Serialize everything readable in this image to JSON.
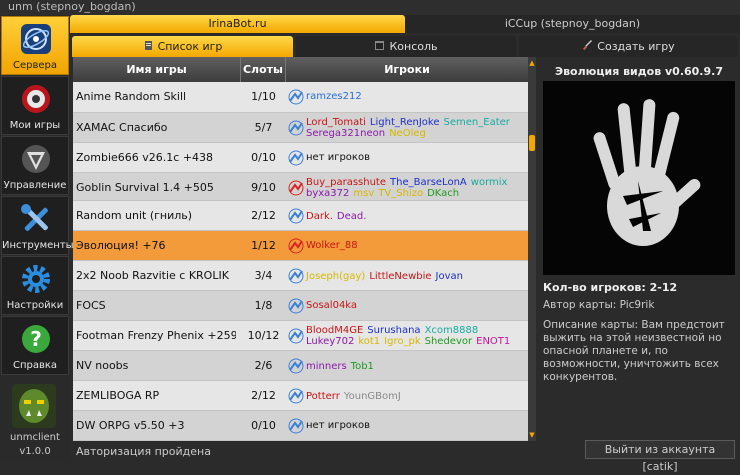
{
  "window": {
    "title": "unm (stepnoy_bogdan)"
  },
  "sidebar": {
    "items": [
      {
        "label": "Сервера",
        "icon": "globe-icon"
      },
      {
        "label": "Мои игры",
        "icon": "joystick-icon"
      },
      {
        "label": "Управление",
        "icon": "dota-logo-icon"
      },
      {
        "label": "Инструменты",
        "icon": "tools-icon"
      },
      {
        "label": "Настройки",
        "icon": "gear-icon"
      },
      {
        "label": "Справка",
        "icon": "help-icon"
      }
    ],
    "client": {
      "name": "unmclient",
      "version": "v1.0.0"
    }
  },
  "tabs": {
    "server1": "IrinaBot.ru",
    "server2": "iCCup (stepnoy_bogdan)"
  },
  "subtabs": {
    "games": "Список игр",
    "console": "Консоль",
    "create": "Создать игру"
  },
  "table": {
    "headers": {
      "name": "Имя игры",
      "slots": "Слоты",
      "players": "Игроки"
    },
    "rows": [
      {
        "name": "Anime Random Skill",
        "slots": "1/10",
        "players": [
          {
            "n": "ramzes212",
            "c": "#2a6fd6"
          }
        ]
      },
      {
        "name": "XAMAC Спасибо",
        "slots": "5/7",
        "players": [
          {
            "n": "Lord_Tomati",
            "c": "#c71515"
          },
          {
            "n": "Light_RenJoke",
            "c": "#1c2fc9"
          },
          {
            "n": "Semen_Eater",
            "c": "#18aaa0"
          },
          {
            "n": "Serega321neon",
            "c": "#8a1aa8"
          },
          {
            "n": "NeOleg",
            "c": "#d6b800"
          }
        ]
      },
      {
        "name": "Zombie666 v26.1c +438",
        "slots": "0/10",
        "players": [
          {
            "n": "нет игроков",
            "c": "#111111"
          }
        ]
      },
      {
        "name": "Goblin Survival 1.4 +505",
        "slots": "9/10",
        "players": [
          {
            "n": "Buy_parasshute",
            "c": "#c71515"
          },
          {
            "n": "The_BarseLonA",
            "c": "#1c2fc9"
          },
          {
            "n": "wormix",
            "c": "#18aaa0"
          },
          {
            "n": "byxa372",
            "c": "#8a1aa8"
          },
          {
            "n": "msv",
            "c": "#d6b800"
          },
          {
            "n": "TV_Shizo",
            "c": "#d6b800"
          },
          {
            "n": "DKach",
            "c": "#1f9a1f"
          }
        ]
      },
      {
        "name": "Random unit (гниль)",
        "slots": "2/12",
        "players": [
          {
            "n": "Dark.",
            "c": "#c71515"
          },
          {
            "n": "Dead.",
            "c": "#8a1aa8"
          }
        ]
      },
      {
        "name": "Эволюция!  +76",
        "slots": "1/12",
        "players": [
          {
            "n": "Wolker_88",
            "c": "#c71515"
          }
        ]
      },
      {
        "name": "2x2 Noob Razvitie c KROLIK",
        "slots": "3/4",
        "players": [
          {
            "n": "Joseph(gay)",
            "c": "#d6b800"
          },
          {
            "n": "LittleNewbie",
            "c": "#c71515"
          },
          {
            "n": "Jovan",
            "c": "#1c2fc9"
          }
        ]
      },
      {
        "name": "FOCS",
        "slots": "1/8",
        "players": [
          {
            "n": "Sosal04ka",
            "c": "#c71515"
          }
        ]
      },
      {
        "name": "Footman Frenzy Phenix +2592",
        "slots": "10/12",
        "players": [
          {
            "n": "BloodM4GE",
            "c": "#c71515"
          },
          {
            "n": "Surushana",
            "c": "#1c2fc9"
          },
          {
            "n": "Xcom8888",
            "c": "#18aaa0"
          },
          {
            "n": "Lukey702",
            "c": "#8a1aa8"
          },
          {
            "n": "kot1",
            "c": "#d6b800"
          },
          {
            "n": "Igro_pk",
            "c": "#d6b800"
          },
          {
            "n": "Shedevor",
            "c": "#1f9a1f"
          },
          {
            "n": "ENOT1",
            "c": "#c71599"
          }
        ]
      },
      {
        "name": "NV noobs",
        "slots": "2/6",
        "players": [
          {
            "n": "minners",
            "c": "#8a1aa8"
          },
          {
            "n": "Tob1",
            "c": "#1f9a1f"
          }
        ]
      },
      {
        "name": "ZEMLIBOGA RP",
        "slots": "2/12",
        "players": [
          {
            "n": "Potterr",
            "c": "#c71515"
          },
          {
            "n": "YounGBomJ",
            "c": "#8a8a8a"
          }
        ]
      },
      {
        "name": "DW ORPG v5.50 +3",
        "slots": "0/10",
        "players": [
          {
            "n": "нет игроков",
            "c": "#111111"
          }
        ]
      }
    ]
  },
  "status": "Авторизация пройдена",
  "info": {
    "map_title": "Эволюция видов v0.60.9.7",
    "players_count": "Кол-во игроков: 2-12",
    "author": "Автор карты: Pic9rik",
    "description": "Описание карты: Вам предстоит выжить на этой неизвестной но опасной планете и, по возможности, уничтожить всех конкурентов."
  },
  "logout": "Выйти из аккаунта [catik]",
  "colors": {
    "accent": "#f3a800",
    "selected_row": "#f39a3a"
  }
}
